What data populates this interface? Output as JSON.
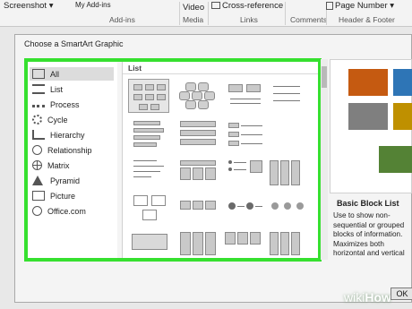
{
  "ribbon": {
    "screenshot": "Screenshot",
    "my_addins": "My Add-ins",
    "video": "Video",
    "cross_reference": "Cross-reference",
    "page_number": "Page Number",
    "groups": {
      "addins": "Add-ins",
      "media": "Media",
      "links": "Links",
      "comments": "Comments",
      "header_footer": "Header & Footer"
    }
  },
  "dialog": {
    "title": "Choose a SmartArt Graphic",
    "categories": [
      {
        "label": "All",
        "icon": "all-grid-icon",
        "selected": true
      },
      {
        "label": "List",
        "icon": "list-icon"
      },
      {
        "label": "Process",
        "icon": "process-icon"
      },
      {
        "label": "Cycle",
        "icon": "cycle-icon"
      },
      {
        "label": "Hierarchy",
        "icon": "hierarchy-icon"
      },
      {
        "label": "Relationship",
        "icon": "relationship-icon"
      },
      {
        "label": "Matrix",
        "icon": "matrix-icon"
      },
      {
        "label": "Pyramid",
        "icon": "pyramid-icon"
      },
      {
        "label": "Picture",
        "icon": "picture-icon"
      },
      {
        "label": "Office.com",
        "icon": "globe-icon"
      }
    ],
    "gallery_heading": "List",
    "preview": {
      "title": "Basic Block List",
      "description": "Use to show non-sequential or grouped blocks of information. Maximizes both horizontal and vertical display space for shapes.",
      "colors": {
        "orange": "#c55a11",
        "blue": "#2e75b6",
        "gray": "#7f7f7f",
        "gold": "#bf9000",
        "green": "#548235"
      }
    },
    "ok_label": "OK"
  },
  "highlight_color": "#36e02f",
  "watermark": {
    "prefix": "wiki",
    "suffix": "How"
  }
}
